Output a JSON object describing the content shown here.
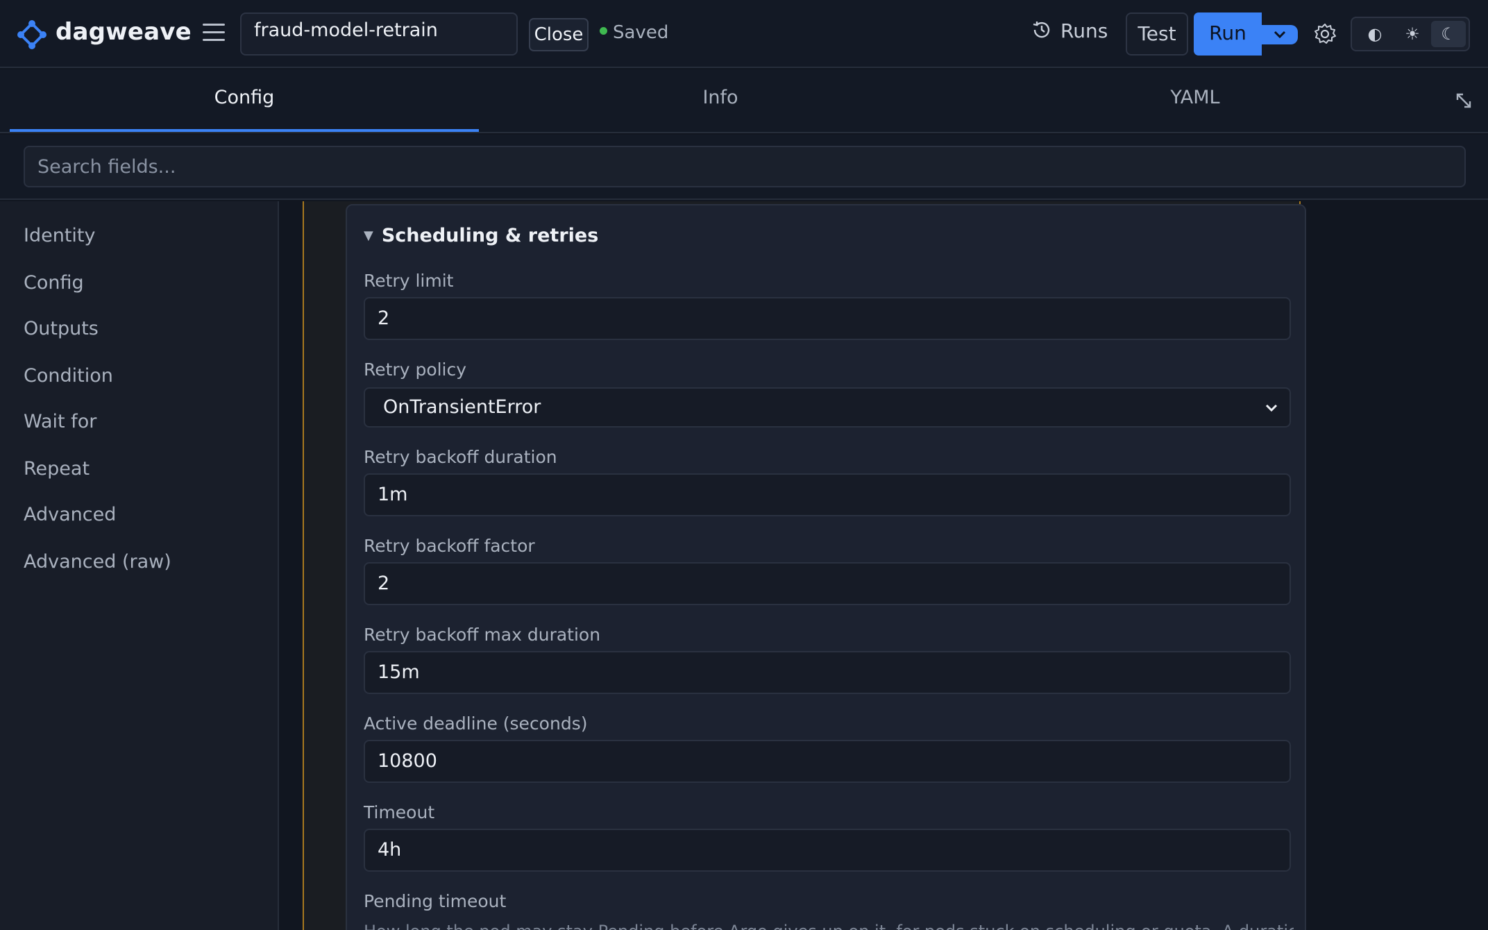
{
  "app": {
    "brand": "dagweave",
    "workflow_name": "fraud-model-retrain",
    "close_label": "Close",
    "status_label": "Saved",
    "runs_label": "Runs",
    "test_label": "Test",
    "run_label": "Run",
    "theme_options": [
      "◐",
      "☀",
      "☾"
    ],
    "active_theme": "dark"
  },
  "tabs": [
    {
      "label": "Config",
      "active": true
    },
    {
      "label": "Info",
      "active": false
    },
    {
      "label": "YAML",
      "active": false
    }
  ],
  "search": {
    "placeholder": "Search fields..."
  },
  "sidebar": {
    "items": [
      {
        "label": "Identity"
      },
      {
        "label": "Config"
      },
      {
        "label": "Outputs"
      },
      {
        "label": "Condition"
      },
      {
        "label": "Wait for"
      },
      {
        "label": "Repeat"
      },
      {
        "label": "Advanced"
      },
      {
        "label": "Advanced (raw)"
      }
    ]
  },
  "section": {
    "title": "Scheduling & retries",
    "collapse_glyph": "▼",
    "fields": [
      {
        "label": "Retry limit",
        "value": "2",
        "type": "text"
      },
      {
        "label": "Retry policy",
        "value": "OnTransientError",
        "type": "select"
      },
      {
        "label": "Retry backoff duration",
        "value": "1m",
        "type": "text"
      },
      {
        "label": "Retry backoff factor",
        "value": "2",
        "type": "text"
      },
      {
        "label": "Retry backoff max duration",
        "value": "15m",
        "type": "text"
      },
      {
        "label": "Active deadline (seconds)",
        "value": "10800",
        "type": "text"
      },
      {
        "label": "Timeout",
        "value": "4h",
        "type": "text"
      }
    ],
    "pending_label": "Pending timeout",
    "pending_help": "How long the pod may stay Pending before Argo gives up on it, for pods stuck on scheduling or quota. A duration string"
  },
  "colors": {
    "accent": "#3b82f6",
    "saved_dot": "#3fb950",
    "highlight_border": "#a8791f"
  }
}
